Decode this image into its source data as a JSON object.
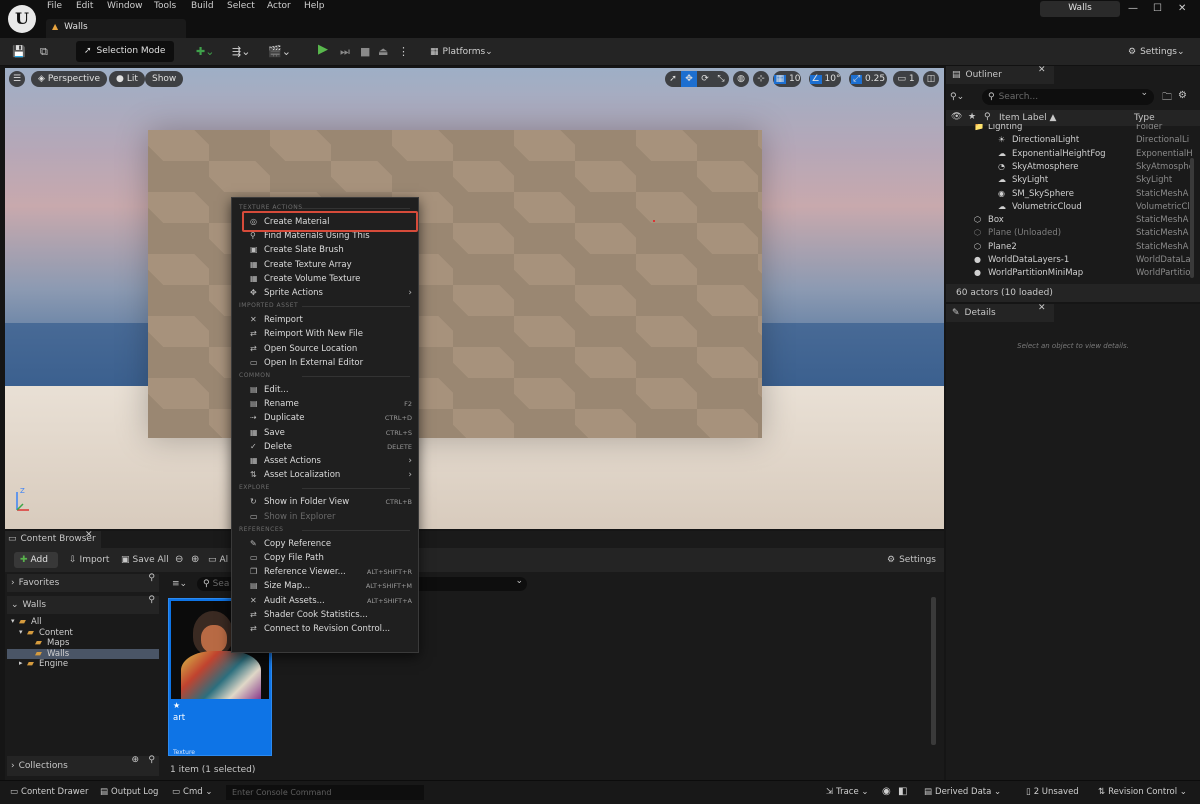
{
  "menu": [
    "File",
    "Edit",
    "Window",
    "Tools",
    "Build",
    "Select",
    "Actor",
    "Help"
  ],
  "level_tab": "Walls",
  "project_name": "Walls",
  "toolbar": {
    "mode": "Selection Mode",
    "platforms": "Platforms",
    "settings": "Settings"
  },
  "viewport": {
    "perspective": "Perspective",
    "lit": "Lit",
    "show": "Show",
    "grid_snap": "10",
    "rotate_snap": "10°",
    "scale_snap": "0.25",
    "camera_speed": "1"
  },
  "context_menu": {
    "sections": [
      "TEXTURE ACTIONS",
      "IMPORTED ASSET",
      "COMMON",
      "EXPLORE",
      "REFERENCES"
    ],
    "texture_actions": [
      {
        "label": "Create Material",
        "icon": "material-icon"
      },
      {
        "label": "Find Materials Using This",
        "icon": "search-icon"
      },
      {
        "label": "Create Slate Brush",
        "icon": "brush-icon"
      },
      {
        "label": "Create Texture Array",
        "icon": "grid-icon"
      },
      {
        "label": "Create Volume Texture",
        "icon": "grid-icon"
      },
      {
        "label": "Sprite Actions",
        "icon": "sprite-icon",
        "submenu": true
      }
    ],
    "imported_asset": [
      {
        "label": "Reimport"
      },
      {
        "label": "Reimport With New File"
      },
      {
        "label": "Open Source Location"
      },
      {
        "label": "Open In External Editor"
      }
    ],
    "common": [
      {
        "label": "Edit...",
        "shortcut": ""
      },
      {
        "label": "Rename",
        "shortcut": "F2"
      },
      {
        "label": "Duplicate",
        "shortcut": "CTRL+D"
      },
      {
        "label": "Save",
        "shortcut": "CTRL+S"
      },
      {
        "label": "Delete",
        "shortcut": "DELETE"
      },
      {
        "label": "Asset Actions",
        "submenu": true
      },
      {
        "label": "Asset Localization",
        "submenu": true
      }
    ],
    "explore": [
      {
        "label": "Show in Folder View",
        "shortcut": "CTRL+B"
      },
      {
        "label": "Show in Explorer",
        "disabled": true
      }
    ],
    "references": [
      {
        "label": "Copy Reference",
        "shortcut": ""
      },
      {
        "label": "Copy File Path",
        "shortcut": ""
      },
      {
        "label": "Reference Viewer...",
        "shortcut": "ALT+SHIFT+R"
      },
      {
        "label": "Size Map...",
        "shortcut": "ALT+SHIFT+M"
      },
      {
        "label": "Audit Assets...",
        "shortcut": "ALT+SHIFT+A"
      },
      {
        "label": "Shader Cook Statistics...",
        "shortcut": ""
      },
      {
        "label": "Connect to Revision Control...",
        "shortcut": ""
      }
    ]
  },
  "outliner": {
    "title": "Outliner",
    "search_placeholder": "Search...",
    "col_label": "Item Label ▲",
    "col_type": "Type",
    "rows": [
      {
        "label": "Lighting",
        "type": "Folder",
        "indent": 2
      },
      {
        "label": "DirectionalLight",
        "type": "DirectionalLi",
        "indent": 3
      },
      {
        "label": "ExponentialHeightFog",
        "type": "ExponentialH",
        "indent": 3
      },
      {
        "label": "SkyAtmosphere",
        "type": "SkyAtmosphe",
        "indent": 3
      },
      {
        "label": "SkyLight",
        "type": "SkyLight",
        "indent": 3
      },
      {
        "label": "SM_SkySphere",
        "type": "StaticMeshA",
        "indent": 3
      },
      {
        "label": "VolumetricCloud",
        "type": "VolumetricClo",
        "indent": 3
      },
      {
        "label": "Box",
        "type": "StaticMeshA",
        "indent": 2
      },
      {
        "label": "Plane (Unloaded)",
        "type": "StaticMeshA",
        "indent": 2,
        "unloaded": true
      },
      {
        "label": "Plane2",
        "type": "StaticMeshA",
        "indent": 2
      },
      {
        "label": "WorldDataLayers-1",
        "type": "WorldDataLa",
        "indent": 2
      },
      {
        "label": "WorldPartitionMiniMap",
        "type": "WorldPartitio",
        "indent": 2
      }
    ],
    "footer": "60 actors (10 loaded)"
  },
  "details": {
    "title": "Details",
    "empty": "Select an object to view details."
  },
  "content_browser": {
    "title": "Content Browser",
    "add": "Add",
    "import": "Import",
    "save_all": "Save All",
    "breadcrumb": "Al",
    "settings": "Settings",
    "search_placeholder": "Sea",
    "favorites": "Favorites",
    "project": "Walls",
    "tree": [
      {
        "label": "All",
        "indent": 0
      },
      {
        "label": "Content",
        "indent": 1
      },
      {
        "label": "Maps",
        "indent": 2
      },
      {
        "label": "Walls",
        "indent": 2,
        "selected": true
      },
      {
        "label": "Engine",
        "indent": 1
      }
    ],
    "collections": "Collections",
    "asset_name": "art",
    "asset_type": "Texture",
    "footer": "1 item (1 selected)"
  },
  "status_bar": {
    "content_drawer": "Content Drawer",
    "output_log": "Output Log",
    "cmd": "Cmd",
    "console_placeholder": "Enter Console Command",
    "trace": "Trace",
    "derived_data": "Derived Data",
    "unsaved": "2 Unsaved",
    "revision_control": "Revision Control"
  }
}
